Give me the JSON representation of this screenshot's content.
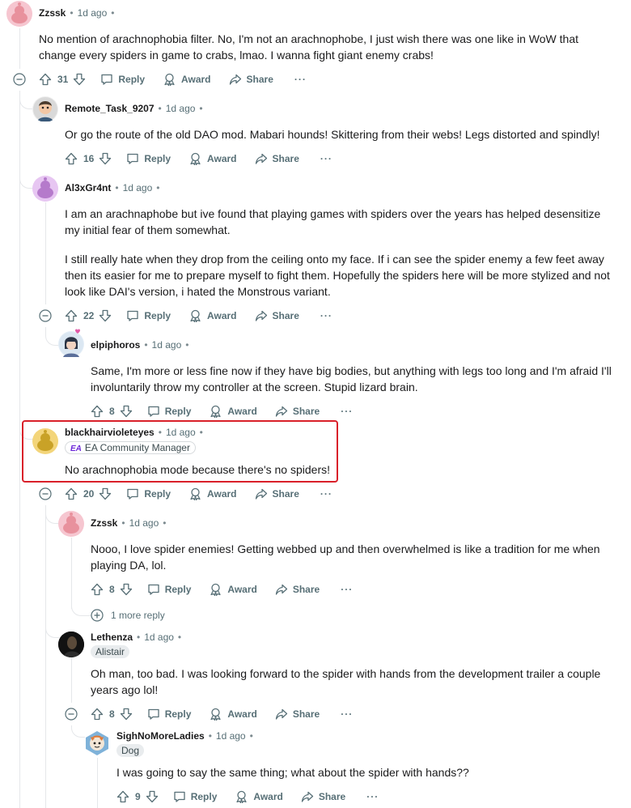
{
  "labels": {
    "reply": "Reply",
    "award": "Award",
    "share": "Share",
    "more": "···",
    "dot": "•"
  },
  "c1": {
    "author": "Zzssk",
    "time": "1d ago",
    "score": "31",
    "text": "No mention of arachnophobia filter. No, I'm not an arachnophobe, I just wish there was one like in WoW that change every spiders in game to crabs, lmao. I wanna fight giant enemy crabs!"
  },
  "c2": {
    "author": "Remote_Task_9207",
    "time": "1d ago",
    "score": "16",
    "text": "Or go the route of the old DAO mod. Mabari hounds! Skittering from their webs! Legs distorted and spindly!"
  },
  "c3": {
    "author": "Al3xGr4nt",
    "time": "1d ago",
    "score": "22",
    "p1": "I am an arachnaphobe but ive found that playing games with spiders over the years has helped desensitize my initial fear of them somewhat.",
    "p2": "I still really hate when they drop from the ceiling onto my face. If i can see the spider enemy a few feet away then its easier for me to prepare myself to fight them. Hopefully the spiders here will be more stylized and not look like DAI's version, i hated the Monstrous variant."
  },
  "c4": {
    "author": "elpiphoros",
    "time": "1d ago",
    "score": "8",
    "text": "Same, I'm more or less fine now if they have big bodies, but anything with legs too long and I'm afraid I'll involuntarily throw my controller at the screen. Stupid lizard brain."
  },
  "c5": {
    "author": "blackhairvioleteyes",
    "time": "1d ago",
    "score": "20",
    "flair": "EA Community Manager",
    "flair_logo": "EA",
    "flair_logo_color": "#6d28d9",
    "text": "No arachnophobia mode because there's no spiders!"
  },
  "c6": {
    "author": "Zzssk",
    "time": "1d ago",
    "score": "8",
    "text": "Nooo, I love spider enemies! Getting webbed up and then overwhelmed is like a tradition for me when playing DA, lol.",
    "more_replies": "1 more reply"
  },
  "c7": {
    "author": "Lethenza",
    "time": "1d ago",
    "score": "8",
    "flair": "Alistair",
    "text": "Oh man, too bad. I was looking forward to the spider with hands from the development trailer a couple years ago lol!"
  },
  "c8": {
    "author": "SighNoMoreLadies",
    "time": "1d ago",
    "score": "9",
    "flair": "Dog",
    "text": "I was going to say the same thing; what about the spider with hands??"
  },
  "colors": {
    "highlight_border": "#d9202a",
    "meta_text": "#576f76",
    "thread_line": "#e5e7ea"
  }
}
